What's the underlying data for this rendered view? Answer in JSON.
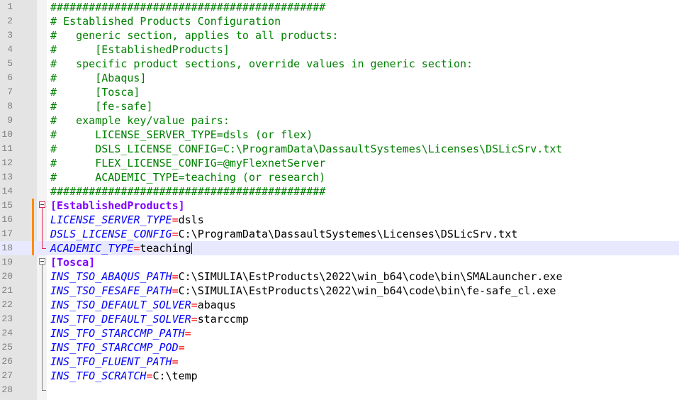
{
  "editor": {
    "lines": [
      {
        "n": "1",
        "type": "comment",
        "text": "###########################################"
      },
      {
        "n": "2",
        "type": "comment",
        "text": "# Established Products Configuration"
      },
      {
        "n": "3",
        "type": "comment",
        "text": "#   generic section, applies to all products:"
      },
      {
        "n": "4",
        "type": "comment",
        "text": "#      [EstablishedProducts]"
      },
      {
        "n": "5",
        "type": "comment",
        "text": "#   specific product sections, override values in generic section:"
      },
      {
        "n": "6",
        "type": "comment",
        "text": "#      [Abaqus]"
      },
      {
        "n": "7",
        "type": "comment",
        "text": "#      [Tosca]"
      },
      {
        "n": "8",
        "type": "comment",
        "text": "#      [fe-safe]"
      },
      {
        "n": "9",
        "type": "comment",
        "text": "#   example key/value pairs:"
      },
      {
        "n": "10",
        "type": "comment",
        "text": "#      LICENSE_SERVER_TYPE=dsls (or flex)"
      },
      {
        "n": "11",
        "type": "comment",
        "text": "#      DSLS_LICENSE_CONFIG=C:\\ProgramData\\DassaultSystemes\\Licenses\\DSLicSrv.txt"
      },
      {
        "n": "12",
        "type": "comment",
        "text": "#      FLEX_LICENSE_CONFIG=@myFlexnetServer"
      },
      {
        "n": "13",
        "type": "comment",
        "text": "#      ACADEMIC_TYPE=teaching (or research)"
      },
      {
        "n": "14",
        "type": "comment",
        "text": "###########################################"
      },
      {
        "n": "15",
        "type": "section",
        "text": "[EstablishedProducts]"
      },
      {
        "n": "16",
        "type": "kv",
        "key": "LICENSE_SERVER_TYPE",
        "eq": "=",
        "value": "dsls"
      },
      {
        "n": "17",
        "type": "kv",
        "key": "DSLS_LICENSE_CONFIG",
        "eq": "=",
        "value": "C:\\ProgramData\\DassaultSystemes\\Licenses\\DSLicSrv.txt"
      },
      {
        "n": "18",
        "type": "kv",
        "key": "ACADEMIC_TYPE",
        "eq": "=",
        "value": "teaching"
      },
      {
        "n": "19",
        "type": "section",
        "text": "[Tosca]"
      },
      {
        "n": "20",
        "type": "kv",
        "key": "INS_TSO_ABAQUS_PATH",
        "eq": "=",
        "value": "C:\\SIMULIA\\EstProducts\\2022\\win_b64\\code\\bin\\SMALauncher.exe"
      },
      {
        "n": "21",
        "type": "kv",
        "key": "INS_TSO_FESAFE_PATH",
        "eq": "=",
        "value": "C:\\SIMULIA\\EstProducts\\2022\\win_b64\\code\\bin\\fe-safe_cl.exe"
      },
      {
        "n": "22",
        "type": "kv",
        "key": "INS_TSO_DEFAULT_SOLVER",
        "eq": "=",
        "value": "abaqus"
      },
      {
        "n": "23",
        "type": "kv",
        "key": "INS_TFO_DEFAULT_SOLVER",
        "eq": "=",
        "value": "starccmp"
      },
      {
        "n": "24",
        "type": "kv",
        "key": "INS_TFO_STARCCMP_PATH",
        "eq": "=",
        "value": ""
      },
      {
        "n": "25",
        "type": "kv",
        "key": "INS_TFO_STARCCMP_POD",
        "eq": "=",
        "value": ""
      },
      {
        "n": "26",
        "type": "kv",
        "key": "INS_TFO_FLUENT_PATH",
        "eq": "=",
        "value": ""
      },
      {
        "n": "27",
        "type": "kv",
        "key": "INS_TFO_SCRATCH",
        "eq": "=",
        "value": "C:\\temp"
      },
      {
        "n": "28",
        "type": "empty",
        "text": ""
      }
    ],
    "current_line": "18",
    "colors": {
      "comment": "#008000",
      "section": "#8000ff",
      "key": "#0000ff",
      "operator": "#ff0000",
      "current_line_bg": "#e8e8ff",
      "change_bar": "#ff8c00"
    }
  }
}
